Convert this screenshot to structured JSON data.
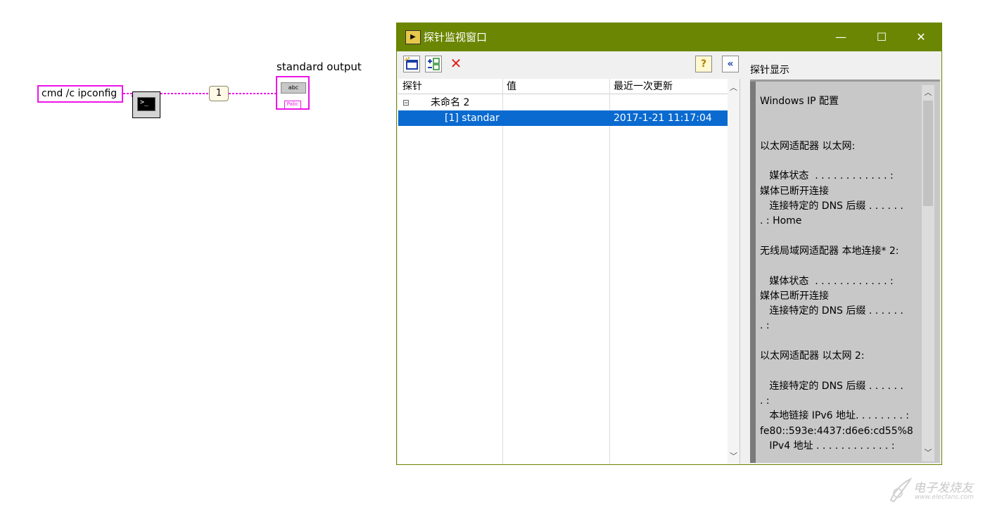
{
  "diagram": {
    "string_constant": "cmd /c ipconfig",
    "index_constant": "1",
    "indicator_label": "standard output",
    "indicator_glyph": "abc",
    "indicator_sub_glyph": "Pabc",
    "exec_glyph": ">_",
    "wire_color": "#ec15e8"
  },
  "probe_window": {
    "title": "探针监视窗口",
    "app_icon": "probe-icon",
    "controls": {
      "minimize": "—",
      "maximize": "☐",
      "close": "✕"
    },
    "toolbar": {
      "help": "?",
      "collapse": "«",
      "delete": "✕"
    },
    "columns": [
      "探针",
      "值",
      "最近一次更新"
    ],
    "rows": [
      {
        "expander": "⊟",
        "probe": "未命名 2",
        "value": "",
        "updated": ""
      },
      {
        "expander": "",
        "probe": "[1] standar",
        "value": "",
        "updated": "2017-1-21 11:17:04"
      }
    ],
    "display_label": "探针显示",
    "display_text": "Windows IP 配置\n\n\n以太网适配器 以太网:\n\n   媒体状态  . . . . . . . . . . . . :\n媒体已断开连接\n   连接特定的 DNS 后缀 . . . . . .\n. : Home\n\n无线局域网适配器 本地连接* 2:\n\n   媒体状态  . . . . . . . . . . . . :\n媒体已断开连接\n   连接特定的 DNS 后缀 . . . . . .\n. :\n\n以太网适配器 以太网 2:\n\n   连接特定的 DNS 后缀 . . . . . .\n. :\n   本地链接 IPv6 地址. . . . . . . . :\nfe80::593e:4437:d6e6:cd55%8\n   IPv4 地址 . . . . . . . . . . . . :"
  },
  "watermark": {
    "line1": "电子发烧友",
    "line2": "www.elecfans.com"
  },
  "colors": {
    "titlebar": "#6b8602",
    "selection": "#0a6ad0",
    "wire": "#ec15e8"
  }
}
